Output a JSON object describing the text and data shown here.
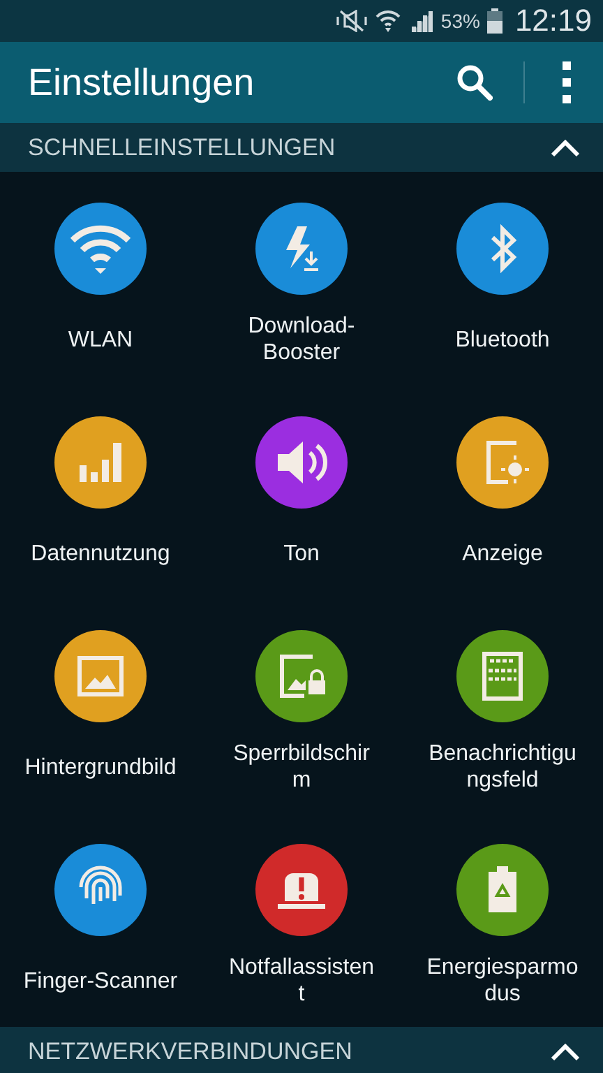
{
  "status_bar": {
    "battery": "53%",
    "time": "12:19"
  },
  "app_bar": {
    "title": "Einstellungen"
  },
  "sections": [
    {
      "title": "SCHNELLEINSTELLUNGEN",
      "expanded": true,
      "items": [
        {
          "kind": "wifi",
          "label": "WLAN",
          "color": "#1a8cd8"
        },
        {
          "kind": "booster",
          "label": "Download-\nBooster",
          "color": "#1a8cd8"
        },
        {
          "kind": "bluetooth",
          "label": "Bluetooth",
          "color": "#1a8cd8"
        },
        {
          "kind": "data",
          "label": "Datennutzung",
          "color": "#e0a020"
        },
        {
          "kind": "sound",
          "label": "Ton",
          "color": "#9b2ee0"
        },
        {
          "kind": "display",
          "label": "Anzeige",
          "color": "#e0a020"
        },
        {
          "kind": "wallpaper",
          "label": "Hintergrundbild",
          "color": "#e0a020"
        },
        {
          "kind": "lockscreen",
          "label": "Sperrbildschir\nm",
          "color": "#5a9a18"
        },
        {
          "kind": "panel",
          "label": "Benachrichtigu\nngsfeld",
          "color": "#5a9a18"
        },
        {
          "kind": "finger",
          "label": "Finger-Scanner",
          "color": "#1a8cd8"
        },
        {
          "kind": "alarm",
          "label": "Notfallassisten\nt",
          "color": "#d02a2a"
        },
        {
          "kind": "battery",
          "label": "Energiesparmo\ndus",
          "color": "#5a9a18"
        }
      ]
    },
    {
      "title": "NETZWERKVERBINDUNGEN",
      "expanded": true
    }
  ]
}
